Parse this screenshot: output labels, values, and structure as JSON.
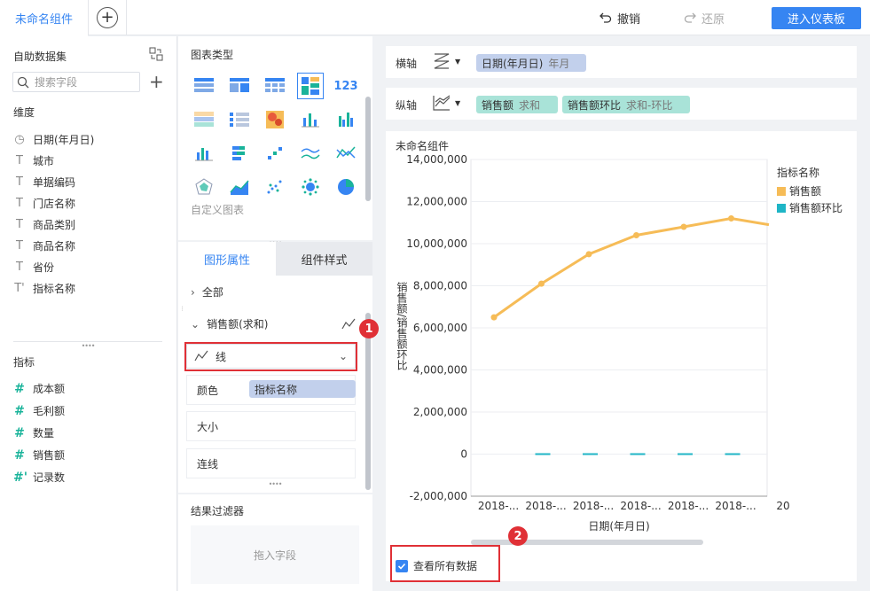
{
  "topbar": {
    "tab_label": "未命名组件",
    "undo_label": "撤销",
    "redo_label": "还原",
    "enter_label": "进入仪表板"
  },
  "data_panel": {
    "title": "自助数据集",
    "search_placeholder": "搜索字段",
    "dimension_heading": "维度",
    "dimensions": [
      {
        "icon": "calendar-icon",
        "label": "日期(年月日)"
      },
      {
        "icon": "text-type-icon",
        "label": "城市"
      },
      {
        "icon": "text-type-icon",
        "label": "单据编码"
      },
      {
        "icon": "text-type-icon",
        "label": "门店名称"
      },
      {
        "icon": "text-type-icon",
        "label": "商品类别"
      },
      {
        "icon": "text-type-icon",
        "label": "商品名称"
      },
      {
        "icon": "text-type-icon",
        "label": "省份"
      },
      {
        "icon": "text-type-icon",
        "label": "指标名称"
      }
    ],
    "measure_heading": "指标",
    "measures": [
      {
        "icon": "number-type-icon",
        "label": "成本额"
      },
      {
        "icon": "number-type-icon",
        "label": "毛利额"
      },
      {
        "icon": "number-type-icon",
        "label": "数量"
      },
      {
        "icon": "number-type-icon",
        "label": "销售额"
      },
      {
        "icon": "number-type-icon",
        "label": "记录数"
      }
    ]
  },
  "chart_types": {
    "title": "图表类型",
    "custom_label": "自定义图表"
  },
  "properties": {
    "tab_shape": "图形属性",
    "tab_style": "组件样式",
    "all_label": "全部",
    "series_label": "销售额(求和)",
    "shape_value": "线",
    "color_label": "颜色",
    "color_field": "指标名称",
    "size_label": "大小",
    "connect_label": "连线"
  },
  "filter": {
    "title": "结果过滤器",
    "drop_hint": "拖入字段"
  },
  "axes": {
    "x_label": "横轴",
    "x_field": "日期(年月日)",
    "x_field_sub": "年月",
    "y_label": "纵轴",
    "y_field_1": "销售额",
    "y_field_1_sub": "求和",
    "y_field_2": "销售额环比",
    "y_field_2_sub": "求和-环比"
  },
  "chart_card": {
    "name": "未命名组件",
    "show_all_label": "查看所有数据",
    "legend_title": "指标名称"
  },
  "annotations": {
    "badge_1": "1",
    "badge_2": "2"
  },
  "colors": {
    "accent": "#3685f2",
    "sales_line": "#f6bc57",
    "ratio_bar": "#1fb5c6",
    "annotation": "#e03036"
  },
  "chart_data": {
    "type": "line",
    "title": "",
    "xlabel": "日期(年月日)",
    "ylabel": "销售额/销售额环比",
    "categories": [
      "2018-...",
      "2018-...",
      "2018-...",
      "2018-...",
      "2018-...",
      "2018-...",
      "20"
    ],
    "ylim": [
      -2000000,
      14000000
    ],
    "yticks": [
      -2000000,
      0,
      2000000,
      4000000,
      6000000,
      8000000,
      10000000,
      12000000,
      14000000
    ],
    "ytick_labels": [
      "-2,000,000",
      "0",
      "2,000,000",
      "4,000,000",
      "6,000,000",
      "8,000,000",
      "10,000,000",
      "12,000,000",
      "14,000,000"
    ],
    "grid": true,
    "legend_position": "right",
    "series": [
      {
        "name": "销售额",
        "type": "line",
        "color": "#f6bc57",
        "values": [
          6500000,
          8100000,
          9500000,
          10400000,
          10800000,
          11200000,
          10900000
        ]
      },
      {
        "name": "销售额环比",
        "type": "bar",
        "color": "#1fb5c6",
        "values": [
          null,
          0,
          0,
          0,
          0,
          0,
          null
        ]
      }
    ]
  }
}
